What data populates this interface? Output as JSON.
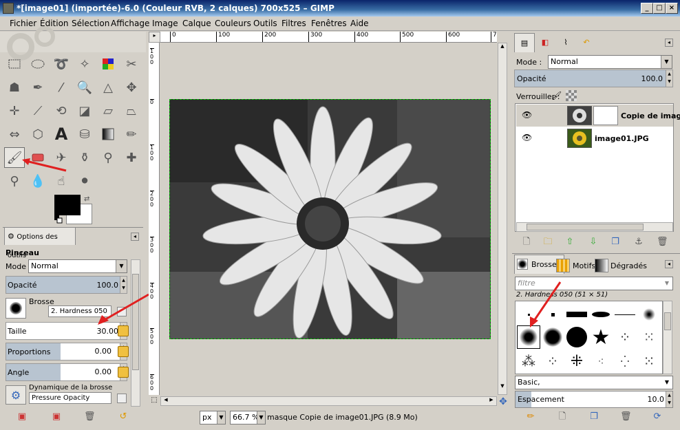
{
  "window": {
    "title": "*[image01] (importée)-6.0 (Couleur RVB, 2 calques) 700x525 – GIMP"
  },
  "menu": [
    "Fichier",
    "Édition",
    "Sélection",
    "Affichage",
    "Image",
    "Calque",
    "Couleurs",
    "Outils",
    "Filtres",
    "Fenêtres",
    "Aide"
  ],
  "tool_options": {
    "tab_label": "Options des outils",
    "tool_name": "Pinceau",
    "mode_label": "Mode :",
    "mode_value": "Normal",
    "opacity_label": "Opacité",
    "opacity_value": "100.0",
    "brush_label": "Brosse",
    "brush_value": "2. Hardness 050",
    "size_label": "Taille",
    "size_value": "30.00",
    "proportions_label": "Proportions",
    "proportions_value": "0.00",
    "angle_label": "Angle",
    "angle_value": "0.00",
    "dynamics_label": "Dynamique de la brosse",
    "dynamics_value": "Pressure Opacity"
  },
  "ruler": {
    "top": [
      "0",
      "100",
      "200",
      "300",
      "400",
      "500",
      "600",
      "7"
    ],
    "left": [
      "0",
      "100",
      "200",
      "300",
      "400",
      "500",
      "600"
    ]
  },
  "status": {
    "unit": "px",
    "zoom": "66.7 %",
    "message": "masque Copie de image01.JPG (8.9 Mo)"
  },
  "layers": {
    "mode_label": "Mode :",
    "mode_value": "Normal",
    "opacity_label": "Opacité",
    "opacity_value": "100.0",
    "lock_label": "Verrouiller :",
    "items": [
      {
        "name": "Copie de image"
      },
      {
        "name": "image01.JPG"
      }
    ]
  },
  "brushes": {
    "tabs": [
      "Brosses",
      "Motifs",
      "Dégradés"
    ],
    "filter_placeholder": "filtre",
    "selected_name": "2. Hardness 050 (51 × 51)",
    "preset": "Basic,",
    "spacing_label": "Espacement",
    "spacing_value": "10.0"
  },
  "colors": {
    "accent": "#0a246a",
    "selection": "#b8c4d0",
    "arrow": "#e02020"
  }
}
